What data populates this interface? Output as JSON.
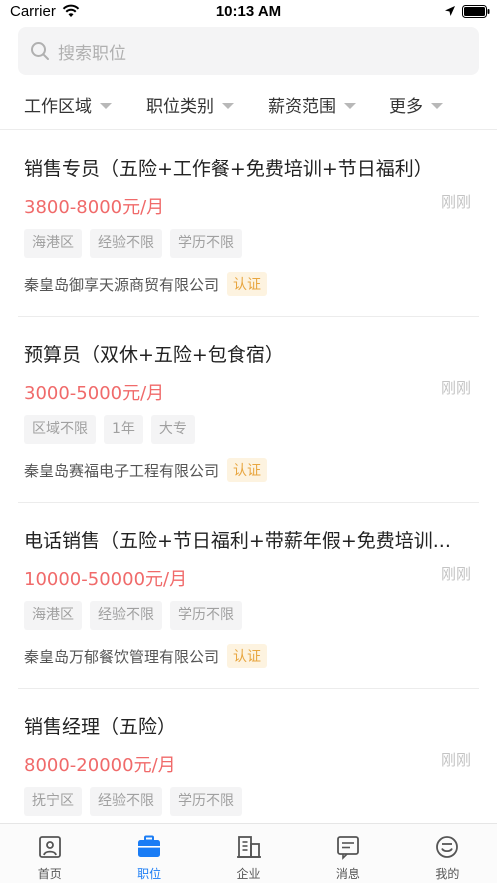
{
  "status_bar": {
    "carrier": "Carrier",
    "time": "10:13 AM"
  },
  "search": {
    "placeholder": "搜索职位"
  },
  "filters": [
    {
      "label": "工作区域"
    },
    {
      "label": "职位类别"
    },
    {
      "label": "薪资范围"
    },
    {
      "label": "更多"
    }
  ],
  "jobs": [
    {
      "title": "销售专员（五险+工作餐+免费培训+节日福利）",
      "salary": "3800-8000元/月",
      "time": "刚刚",
      "tags": [
        "海港区",
        "经验不限",
        "学历不限"
      ],
      "company": "秦皇岛御享天源商贸有限公司",
      "cert": "认证"
    },
    {
      "title": "预算员（双休+五险+包食宿）",
      "salary": "3000-5000元/月",
      "time": "刚刚",
      "tags": [
        "区域不限",
        "1年",
        "大专"
      ],
      "company": "秦皇岛赛福电子工程有限公司",
      "cert": "认证"
    },
    {
      "title": "电话销售（五险+节日福利+带薪年假+免费培训...",
      "salary": "10000-50000元/月",
      "time": "刚刚",
      "tags": [
        "海港区",
        "经验不限",
        "学历不限"
      ],
      "company": "秦皇岛万郁餐饮管理有限公司",
      "cert": "认证"
    },
    {
      "title": "销售经理（五险）",
      "salary": "8000-20000元/月",
      "time": "刚刚",
      "tags": [
        "抚宁区",
        "经验不限",
        "学历不限"
      ],
      "company": "",
      "cert": ""
    }
  ],
  "tabs": [
    {
      "label": "首页",
      "icon": "home-icon"
    },
    {
      "label": "职位",
      "icon": "briefcase-icon",
      "active": true
    },
    {
      "label": "企业",
      "icon": "building-icon"
    },
    {
      "label": "消息",
      "icon": "message-icon"
    },
    {
      "label": "我的",
      "icon": "profile-icon"
    }
  ],
  "colors": {
    "accent": "#1a7cf5",
    "salary": "#f06a6a",
    "cert_text": "#e8a640",
    "cert_bg": "#fdf3e0"
  }
}
